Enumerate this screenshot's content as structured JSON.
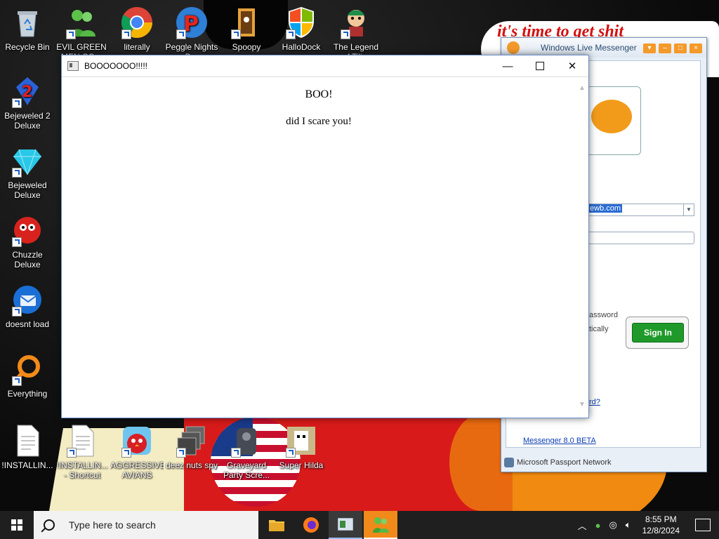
{
  "desktop": {
    "wallpaper_text": "it's time to get shit",
    "icons": [
      {
        "label": "Recycle Bin",
        "icon": "recycle-bin-icon"
      },
      {
        "label": "EVIL GREEN MEN CO...",
        "icon": "msn-men-icon"
      },
      {
        "label": "literally",
        "icon": "chrome-icon"
      },
      {
        "label": "Peggle Nights D...",
        "icon": "peggle-icon"
      },
      {
        "label": "Spoopy",
        "icon": "spoopy-icon"
      },
      {
        "label": "HalloDock",
        "icon": "windows-shield-icon"
      },
      {
        "label": "The Legend of Tili...",
        "icon": "legend-icon"
      },
      {
        "label": "Bejeweled 2 Deluxe",
        "icon": "bejeweled2-icon"
      },
      {
        "label": "Bejeweled Deluxe",
        "icon": "bejeweled-icon"
      },
      {
        "label": "Chuzzle Deluxe",
        "icon": "chuzzle-icon"
      },
      {
        "label": "doesnt load",
        "icon": "thunderbird-icon"
      },
      {
        "label": "Everything",
        "icon": "everything-icon"
      },
      {
        "label": "!INSTALLIN...",
        "icon": "document-icon"
      },
      {
        "label": "!INSTALLIN... - Shortcut",
        "icon": "document-icon"
      },
      {
        "label": "AGGRESSIVE AVIANS",
        "icon": "angry-bird-icon"
      },
      {
        "label": "deez nuts spy",
        "icon": "stacked-windows-icon"
      },
      {
        "label": "Graveyard Party Scre...",
        "icon": "graveyard-icon"
      },
      {
        "label": "Super Hilda",
        "icon": "super-hilda-icon"
      }
    ]
  },
  "boo_window": {
    "title": "BOOOOOOO!!!!!",
    "line1": "BOO!",
    "line2": "did I scare you!"
  },
  "msn": {
    "title": "Windows Live Messenger",
    "email_fragment": "ewb.com",
    "option1_fragment": "assword",
    "option2_fragment": "tically",
    "signin_label": "Sign In",
    "forgot_fragment": "rd?",
    "version_link": "Messenger 8.0 BETA",
    "passport": "Microsoft Passport Network"
  },
  "taskbar": {
    "search_placeholder": "Type here to search",
    "time": "8:55 PM",
    "date": "12/8/2024"
  },
  "colors": {
    "taskbar": "#1f1f1f",
    "signin_green": "#1f9a2a",
    "msn_orange": "#f49a2a"
  }
}
